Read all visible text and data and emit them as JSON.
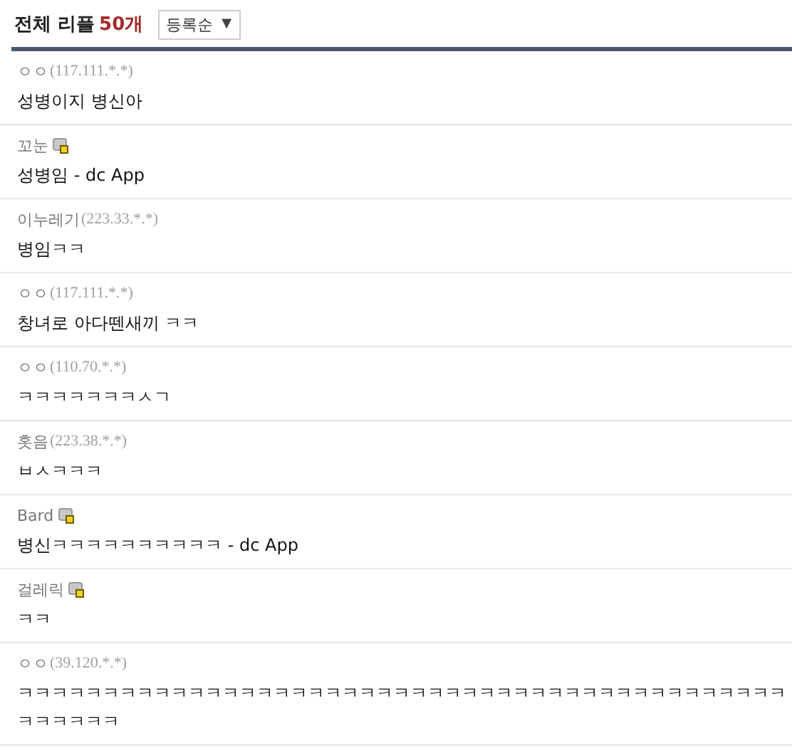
{
  "header": {
    "title": "전체 리플",
    "count": "50개",
    "sort": {
      "value": "등록순",
      "caret": "▼"
    }
  },
  "comments": [
    {
      "name": "ㅇㅇ",
      "ip": "(117.111.*.*)",
      "member": false,
      "text": "성병이지 병신아"
    },
    {
      "name": "꼬눈",
      "member": true,
      "text": "성병임 - dc App"
    },
    {
      "name": "이누레기",
      "ip": "(223.33.*.*)",
      "member": false,
      "text": "병임ㅋㅋ"
    },
    {
      "name": "ㅇㅇ",
      "ip": "(117.111.*.*)",
      "member": false,
      "text": "창녀로 아다뗀새끼 ㅋㅋ"
    },
    {
      "name": "ㅇㅇ",
      "ip": "(110.70.*.*)",
      "member": false,
      "text": "ㅋㅋㅋㅋㅋㅋㅋㅅㄱ"
    },
    {
      "name": "홋음",
      "ip": "(223.38.*.*)",
      "member": false,
      "text": "ㅂㅅㅋㅋㅋ"
    },
    {
      "name": "Bard",
      "member": true,
      "text": "병신ㅋㅋㅋㅋㅋㅋㅋㅋㅋㅋ - dc App"
    },
    {
      "name": "걸레릭",
      "member": true,
      "text": "ㅋㅋ"
    },
    {
      "name": "ㅇㅇ",
      "ip": "(39.120.*.*)",
      "member": false,
      "text": "ㅋㅋㅋㅋㅋㅋㅋㅋㅋㅋㅋㅋㅋㅋㅋㅋㅋㅋㅋㅋㅋㅋㅋㅋㅋㅋㅋㅋㅋㅋㅋㅋㅋㅋㅋㅋㅋㅋㅋㅋㅋㅋㅋㅋㅋㅋㅋㅋㅋㅋㅋ"
    }
  ]
}
